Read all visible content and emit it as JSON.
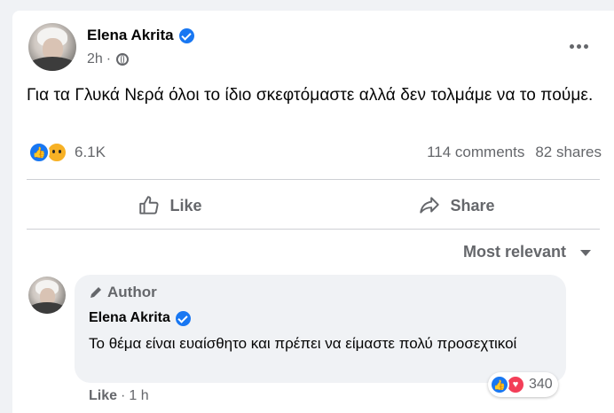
{
  "post": {
    "author": "Elena Akrita",
    "time": "2h",
    "separator": "·",
    "text": "Για τα Γλυκά Νερά όλοι το ίδιο σκεφτόμαστε αλλά δεν τολμάμε να το πούμε.",
    "reaction_count": "6.1K",
    "comments_count": "114 comments",
    "shares_count": "82 shares",
    "reaction_icons": [
      "like-icon",
      "sad-icon"
    ]
  },
  "actions": {
    "like_label": "Like",
    "share_label": "Share"
  },
  "sort": {
    "label": "Most relevant"
  },
  "comment": {
    "badge": "Author",
    "author": "Elena Akrita",
    "text": "Το θέμα είναι ευαίσθητο και πρέπει να είμαστε πολύ προσεχτικοί",
    "like_label": "Like",
    "separator": "·",
    "time": "1 h",
    "reaction_count": "340",
    "reaction_icons": [
      "like-icon",
      "love-icon"
    ]
  },
  "colors": {
    "accent": "#1877f2",
    "secondary_text": "#65676b",
    "background": "#f0f2f5"
  }
}
